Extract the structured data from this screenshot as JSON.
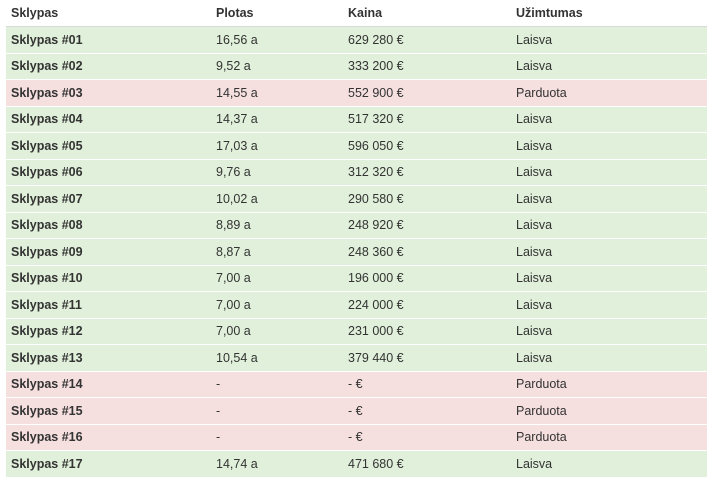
{
  "table": {
    "headers": [
      "Sklypas",
      "Plotas",
      "Kaina",
      "Užimtumas"
    ],
    "rows": [
      {
        "plot": "Sklypas #01",
        "area": "16,56 a",
        "price": "629 280 €",
        "status": "Laisva",
        "available": true
      },
      {
        "plot": "Sklypas #02",
        "area": "9,52 a",
        "price": "333 200 €",
        "status": "Laisva",
        "available": true
      },
      {
        "plot": "Sklypas #03",
        "area": "14,55 a",
        "price": "552 900 €",
        "status": "Parduota",
        "available": false
      },
      {
        "plot": "Sklypas #04",
        "area": "14,37 a",
        "price": "517 320 €",
        "status": "Laisva",
        "available": true
      },
      {
        "plot": "Sklypas #05",
        "area": "17,03 a",
        "price": "596 050 €",
        "status": "Laisva",
        "available": true
      },
      {
        "plot": "Sklypas #06",
        "area": "9,76 a",
        "price": "312 320 €",
        "status": "Laisva",
        "available": true
      },
      {
        "plot": "Sklypas #07",
        "area": "10,02 a",
        "price": "290 580 €",
        "status": "Laisva",
        "available": true
      },
      {
        "plot": "Sklypas #08",
        "area": "8,89 a",
        "price": "248 920 €",
        "status": "Laisva",
        "available": true
      },
      {
        "plot": "Sklypas #09",
        "area": "8,87 a",
        "price": "248 360 €",
        "status": "Laisva",
        "available": true
      },
      {
        "plot": "Sklypas #10",
        "area": "7,00 a",
        "price": "196 000 €",
        "status": "Laisva",
        "available": true
      },
      {
        "plot": "Sklypas #11",
        "area": "7,00 a",
        "price": "224 000 €",
        "status": "Laisva",
        "available": true
      },
      {
        "plot": "Sklypas #12",
        "area": "7,00 a",
        "price": "231 000 €",
        "status": "Laisva",
        "available": true
      },
      {
        "plot": "Sklypas #13",
        "area": "10,54 a",
        "price": "379 440 €",
        "status": "Laisva",
        "available": true
      },
      {
        "plot": "Sklypas #14",
        "area": "-",
        "price": "- €",
        "status": "Parduota",
        "available": false
      },
      {
        "plot": "Sklypas #15",
        "area": "-",
        "price": "- €",
        "status": "Parduota",
        "available": false
      },
      {
        "plot": "Sklypas #16",
        "area": "-",
        "price": "- €",
        "status": "Parduota",
        "available": false
      },
      {
        "plot": "Sklypas #17",
        "area": "14,74 a",
        "price": "471 680 €",
        "status": "Laisva",
        "available": true
      }
    ]
  },
  "colors": {
    "available_row": "#e1f0da",
    "sold_row": "#f5dfdf"
  }
}
